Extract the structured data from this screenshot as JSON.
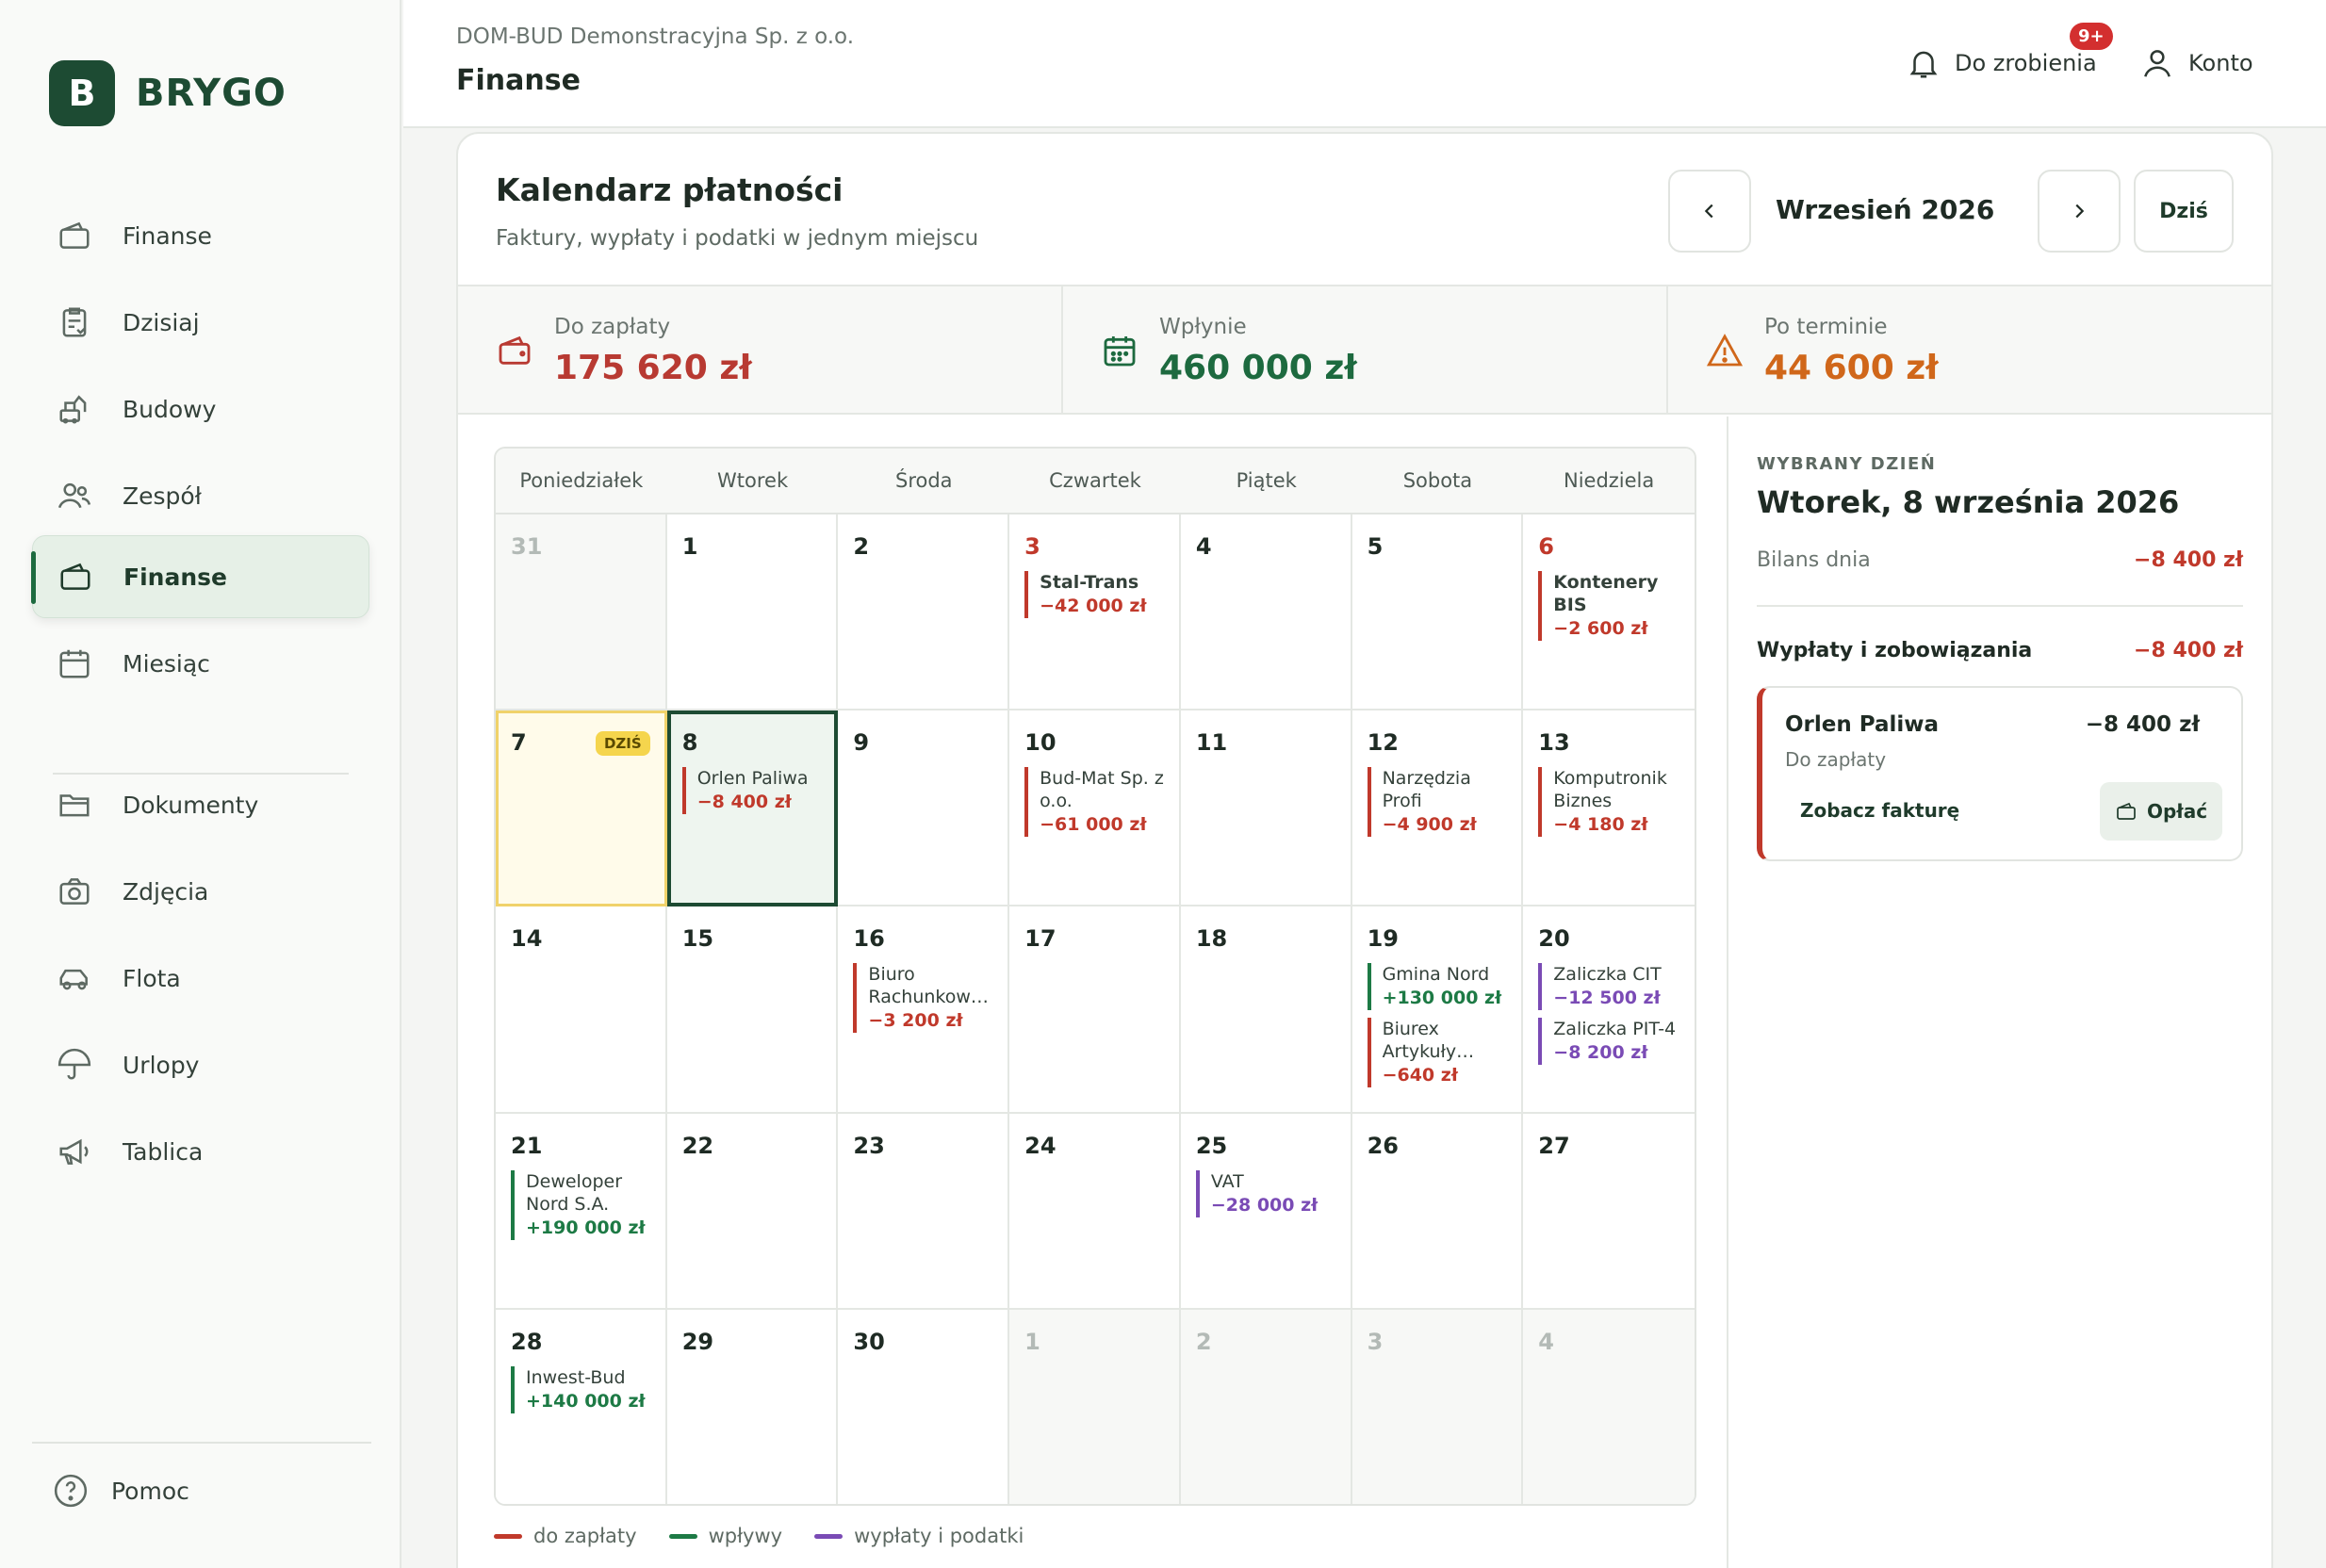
{
  "brand": {
    "mark": "B",
    "name": "BRYGO"
  },
  "sidebar": {
    "items": [
      {
        "label": "Finanse",
        "icon": "wallet-icon"
      },
      {
        "label": "Dzisiaj",
        "icon": "clipboard-check-icon"
      },
      {
        "label": "Budowy",
        "icon": "construction-icon"
      },
      {
        "label": "Zespół",
        "icon": "team-icon"
      },
      {
        "label": "Finanse",
        "icon": "wallet-icon",
        "active": true
      },
      {
        "label": "Miesiąc",
        "icon": "calendar-icon"
      },
      {
        "label": "Dokumenty",
        "icon": "folder-icon"
      },
      {
        "label": "Zdjęcia",
        "icon": "camera-icon"
      },
      {
        "label": "Flota",
        "icon": "car-icon"
      },
      {
        "label": "Urlopy",
        "icon": "umbrella-icon"
      },
      {
        "label": "Tablica",
        "icon": "megaphone-icon"
      }
    ],
    "help": "Pomoc"
  },
  "header": {
    "company": "DOM-BUD Demonstracyjna Sp. z o.o.",
    "title": "Finanse",
    "todo_label": "Do zrobienia",
    "todo_badge": "9+",
    "account_label": "Konto"
  },
  "calendar": {
    "title": "Kalendarz płatności",
    "subtitle": "Faktury, wypłaty i podatki w jednym miejscu",
    "month": "Wrzesień 2026",
    "today_button": "Dziś",
    "today_tag": "DZIŚ",
    "weekdays": [
      "Poniedziałek",
      "Wtorek",
      "Środa",
      "Czwartek",
      "Piątek",
      "Sobota",
      "Niedziela"
    ],
    "days": [
      {
        "n": "31",
        "other": true,
        "events": []
      },
      {
        "n": "1",
        "events": []
      },
      {
        "n": "2",
        "events": []
      },
      {
        "n": "3",
        "red": true,
        "events": [
          {
            "name": "Stal-Trans",
            "amount": "−42 000 zł",
            "type": "red",
            "bold": true
          }
        ]
      },
      {
        "n": "4",
        "events": []
      },
      {
        "n": "5",
        "events": []
      },
      {
        "n": "6",
        "red": true,
        "events": [
          {
            "name": "Kontenery BIS",
            "amount": "−2 600 zł",
            "type": "red",
            "bold": true
          }
        ]
      },
      {
        "n": "7",
        "today": true,
        "events": []
      },
      {
        "n": "8",
        "selected": true,
        "events": [
          {
            "name": "Orlen Paliwa",
            "amount": "−8 400 zł",
            "type": "red"
          }
        ]
      },
      {
        "n": "9",
        "events": []
      },
      {
        "n": "10",
        "events": [
          {
            "name": "Bud-Mat Sp. z o.o.",
            "amount": "−61 000 zł",
            "type": "red"
          }
        ]
      },
      {
        "n": "11",
        "events": []
      },
      {
        "n": "12",
        "events": [
          {
            "name": "Narzędzia Profi",
            "amount": "−4 900 zł",
            "type": "red"
          }
        ]
      },
      {
        "n": "13",
        "events": [
          {
            "name": "Komputronik Biznes",
            "amount": "−4 180 zł",
            "type": "red"
          }
        ]
      },
      {
        "n": "14",
        "events": []
      },
      {
        "n": "15",
        "events": []
      },
      {
        "n": "16",
        "events": [
          {
            "name": "Biuro Rachunkow…",
            "amount": "−3 200 zł",
            "type": "red"
          }
        ]
      },
      {
        "n": "17",
        "events": []
      },
      {
        "n": "18",
        "events": []
      },
      {
        "n": "19",
        "events": [
          {
            "name": "Gmina Nord",
            "amount": "+130 000 zł",
            "type": "green"
          },
          {
            "name": "Biurex Artykuły…",
            "amount": "−640 zł",
            "type": "red"
          }
        ]
      },
      {
        "n": "20",
        "events": [
          {
            "name": "Zaliczka CIT",
            "amount": "−12 500 zł",
            "type": "purple"
          },
          {
            "name": "Zaliczka PIT-4",
            "amount": "−8 200 zł",
            "type": "purple"
          }
        ]
      },
      {
        "n": "21",
        "events": [
          {
            "name": "Deweloper Nord S.A.",
            "amount": "+190 000 zł",
            "type": "green"
          }
        ]
      },
      {
        "n": "22",
        "events": []
      },
      {
        "n": "23",
        "events": []
      },
      {
        "n": "24",
        "events": []
      },
      {
        "n": "25",
        "events": [
          {
            "name": "VAT",
            "amount": "−28 000 zł",
            "type": "purple"
          }
        ]
      },
      {
        "n": "26",
        "events": []
      },
      {
        "n": "27",
        "events": []
      },
      {
        "n": "28",
        "events": [
          {
            "name": "Inwest-Bud",
            "amount": "+140 000 zł",
            "type": "green"
          }
        ]
      },
      {
        "n": "29",
        "events": []
      },
      {
        "n": "30",
        "events": []
      },
      {
        "n": "1",
        "other": true,
        "events": []
      },
      {
        "n": "2",
        "other": true,
        "events": []
      },
      {
        "n": "3",
        "other": true,
        "events": []
      },
      {
        "n": "4",
        "other": true,
        "events": []
      }
    ]
  },
  "stats": [
    {
      "label": "Do zapłaty",
      "value": "175 620 zł",
      "color": "#b83a32",
      "icon": "wallet-icon"
    },
    {
      "label": "Wpłynie",
      "value": "460 000 zł",
      "color": "#1d6a3f",
      "icon": "calendar-icon"
    },
    {
      "label": "Po terminie",
      "value": "44 600 zł",
      "color": "#d0671a",
      "icon": "warning-icon"
    }
  ],
  "legend": [
    {
      "label": "do zapłaty",
      "color": "#c0392b"
    },
    {
      "label": "wpływy",
      "color": "#1d7a45"
    },
    {
      "label": "wypłaty i podatki",
      "color": "#7a4bb5"
    }
  ],
  "day_panel": {
    "kicker": "WYBRANY DZIEŃ",
    "date": "Wtorek, 8 września 2026",
    "balance_label": "Bilans dnia",
    "balance_value": "−8 400 zł",
    "section_label": "Wypłaty i zobowiązania",
    "section_value": "−8 400 zł",
    "item": {
      "name": "Orlen Paliwa",
      "amount": "−8 400 zł",
      "status": "Do zapłaty",
      "link": "Zobacz fakturę",
      "pay_button": "Opłać"
    }
  }
}
